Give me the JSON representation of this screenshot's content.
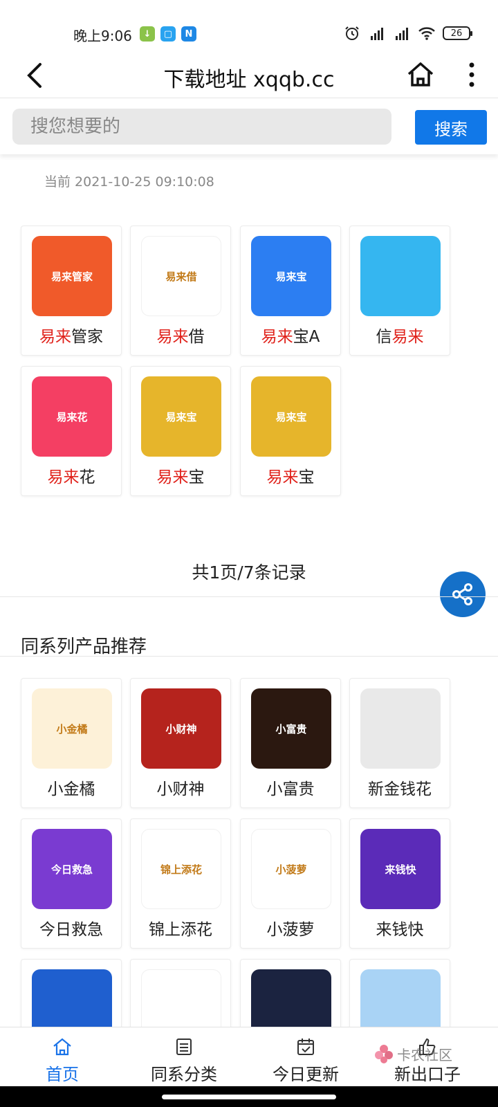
{
  "status_bar": {
    "time": "晚上9:06",
    "app_icons": [
      {
        "name": "download-icon",
        "glyph": "↓",
        "color": "#8bc34a"
      },
      {
        "name": "app-square-icon",
        "glyph": "▢",
        "color": "#29a3f0"
      },
      {
        "name": "n-app-icon",
        "glyph": "N",
        "color": "#1e88e5"
      }
    ],
    "battery": "26"
  },
  "header": {
    "title": "下载地址 xqqb.cc"
  },
  "search": {
    "placeholder": "搜您想要的",
    "button_label": "搜索"
  },
  "timestamp": "当前 2021-10-25 09:10:08",
  "results": [
    {
      "pre": "",
      "hl": "易来",
      "post": "管家",
      "icon": "yilai-guanjia-icon",
      "icon_bg": "#f05a2a",
      "icon_caption": "易来管家"
    },
    {
      "pre": "",
      "hl": "易来",
      "post": "借",
      "icon": "yilai-jie-icon",
      "icon_bg": "#ffffff",
      "icon_caption": "易来借"
    },
    {
      "pre": "",
      "hl": "易来",
      "post": "宝A",
      "icon": "yilai-bao-a-icon",
      "icon_bg": "#2c7ef2",
      "icon_caption": "易来宝"
    },
    {
      "pre": "信",
      "hl": "易来",
      "post": "",
      "icon": "xin-yilai-icon",
      "icon_bg": "#35b6f0",
      "icon_caption": ""
    },
    {
      "pre": "",
      "hl": "易来",
      "post": "花",
      "icon": "yilai-hua-icon",
      "icon_bg": "#f43f63",
      "icon_caption": "易来花"
    },
    {
      "pre": "",
      "hl": "易来",
      "post": "宝",
      "icon": "yilai-bao-gold-icon",
      "icon_bg": "#e6b52b",
      "icon_caption": "易来宝"
    },
    {
      "pre": "",
      "hl": "易来",
      "post": "宝",
      "icon": "yilai-bao-gold-2-icon",
      "icon_bg": "#e6b52b",
      "icon_caption": "易来宝"
    }
  ],
  "pager": "共1页/7条记录",
  "section_title": "同系列产品推荐",
  "recommended": [
    {
      "label": "小金橘",
      "icon": "xiao-jinju-icon",
      "icon_bg": "#fdf1d8",
      "icon_caption": "小金橘"
    },
    {
      "label": "小财神",
      "icon": "xiao-caishen-icon",
      "icon_bg": "#b5231d",
      "icon_caption": "小财神"
    },
    {
      "label": "小富贵",
      "icon": "xiao-fugui-icon",
      "icon_bg": "#2b1810",
      "icon_caption": "小富贵"
    },
    {
      "label": "新金钱花",
      "icon": "xin-jinqianhua-icon",
      "icon_bg": "#e9e9e9",
      "icon_caption": ""
    },
    {
      "label": "今日救急",
      "icon": "jinri-jiuji-icon",
      "icon_bg": "#7a3bd1",
      "icon_caption": "今日救急"
    },
    {
      "label": "锦上添花",
      "icon": "jinshang-tianhua-icon",
      "icon_bg": "#ffffff",
      "icon_caption": "锦上添花"
    },
    {
      "label": "小菠萝",
      "icon": "xiao-boluo-icon",
      "icon_bg": "#ffffff",
      "icon_caption": "小菠萝"
    },
    {
      "label": "来钱快",
      "icon": "lai-qian-kuai-icon",
      "icon_bg": "#5b2bb8",
      "icon_caption": "来钱快"
    },
    {
      "label": "",
      "icon": "blue-app-icon",
      "icon_bg": "#1f5fcf",
      "icon_caption": ""
    },
    {
      "label": "",
      "icon": "watermelon-app-icon",
      "icon_bg": "#ffffff",
      "icon_caption": ""
    },
    {
      "label": "",
      "icon": "rabbit-app-icon",
      "icon_bg": "#1b2340",
      "icon_caption": ""
    },
    {
      "label": "",
      "icon": "gold-coins-app-icon",
      "icon_bg": "#a9d3f5",
      "icon_caption": ""
    }
  ],
  "bottom_nav": [
    {
      "label": "首页",
      "icon": "home-icon",
      "active": true
    },
    {
      "label": "同系分类",
      "icon": "list-icon",
      "active": false
    },
    {
      "label": "今日更新",
      "icon": "calendar-icon",
      "active": false
    },
    {
      "label": "新出口子",
      "icon": "thumbs-up-icon",
      "active": false
    }
  ],
  "watermark": "卡农社区",
  "colors": {
    "accent": "#1178e8",
    "highlight": "#e0221b",
    "share_button": "#1570c8"
  }
}
